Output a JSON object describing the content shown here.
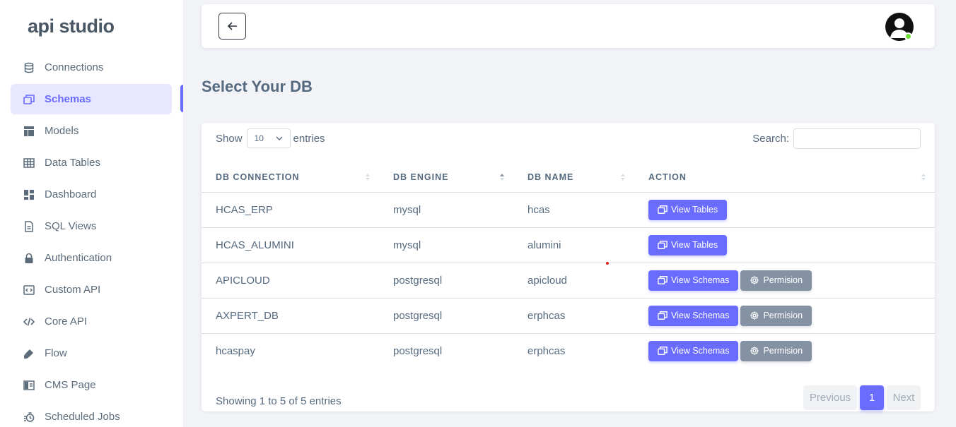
{
  "brand": "api studio",
  "sidebar": {
    "items": [
      {
        "label": "Connections",
        "icon": "database-icon"
      },
      {
        "label": "Schemas",
        "icon": "windows-icon",
        "active": true
      },
      {
        "label": "Models",
        "icon": "layout-icon"
      },
      {
        "label": "Data Tables",
        "icon": "table-icon"
      },
      {
        "label": "Dashboard",
        "icon": "dashboard-icon"
      },
      {
        "label": "SQL Views",
        "icon": "file-icon"
      },
      {
        "label": "Authentication",
        "icon": "lock-icon"
      },
      {
        "label": "Custom API",
        "icon": "code-box-icon"
      },
      {
        "label": "Core API",
        "icon": "code-icon"
      },
      {
        "label": "Flow",
        "icon": "brush-icon"
      },
      {
        "label": "CMS Page",
        "icon": "page-icon"
      },
      {
        "label": "Scheduled Jobs",
        "icon": "timer-icon"
      }
    ]
  },
  "page": {
    "title": "Select Your DB"
  },
  "table_controls": {
    "show_label": "Show",
    "length_value": "10",
    "entries_label": "entries",
    "search_label": "Search:",
    "search_value": ""
  },
  "columns": [
    "DB CONNECTION",
    "DB ENGINE",
    "DB NAME",
    "ACTION"
  ],
  "rows": [
    {
      "connection": "HCAS_ERP",
      "engine": "mysql",
      "name": "hcas",
      "primary_action": "View Tables",
      "secondary_action": null
    },
    {
      "connection": "HCAS_ALUMINI",
      "engine": "mysql",
      "name": "alumini",
      "primary_action": "View Tables",
      "secondary_action": null
    },
    {
      "connection": "APICLOUD",
      "engine": "postgresql",
      "name": "apicloud",
      "primary_action": "View Schemas",
      "secondary_action": "Permision"
    },
    {
      "connection": "AXPERT_DB",
      "engine": "postgresql",
      "name": "erphcas",
      "primary_action": "View Schemas",
      "secondary_action": "Permision"
    },
    {
      "connection": "hcaspay",
      "engine": "postgresql",
      "name": "erphcas",
      "primary_action": "View Schemas",
      "secondary_action": "Permision"
    }
  ],
  "footer": {
    "info": "Showing 1 to 5 of 5 entries",
    "previous": "Previous",
    "page": "1",
    "next": "Next"
  },
  "colors": {
    "accent": "#696cff",
    "secondary": "#8592a3",
    "online": "#71dd37"
  }
}
